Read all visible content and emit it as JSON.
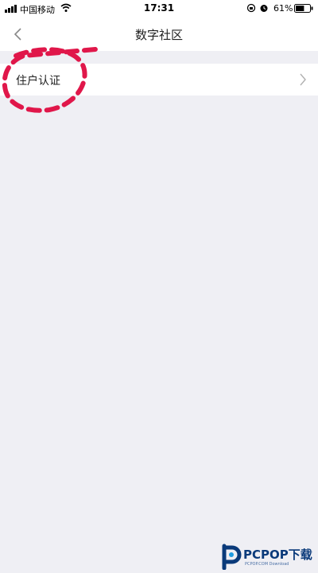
{
  "status_bar": {
    "carrier": "中国移动",
    "time": "17:31",
    "battery_percent": "61%",
    "battery_level": 0.61,
    "icons": [
      "signal-icon",
      "wifi-icon",
      "lock-rotation-icon",
      "alarm-icon",
      "battery-icon"
    ]
  },
  "nav": {
    "title": "数字社区",
    "back_icon": "chevron-left-icon"
  },
  "list": {
    "items": [
      {
        "label": "住户认证",
        "icon": "chevron-right-icon"
      }
    ]
  },
  "annotation": {
    "color": "#e0174a",
    "shape": "dashed-circle"
  },
  "watermark": {
    "brand": "PCPOP下载",
    "sub": "PCPOP.COM Download"
  },
  "colors": {
    "background": "#efeff4",
    "surface": "#ffffff",
    "accent_watermark": "#0a3a7a"
  }
}
